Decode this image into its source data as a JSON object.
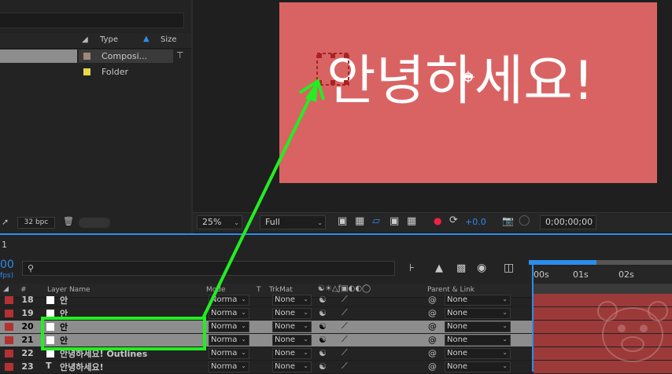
{
  "project": {
    "columns": {
      "tag": "",
      "type": "Type",
      "size": "Size"
    },
    "items": [
      {
        "type": "Composi...",
        "swatch_color": "#a08878",
        "selected": true
      },
      {
        "type": "Folder",
        "swatch_color": "#e8d84a",
        "selected": false
      }
    ],
    "bpc": "32 bpc"
  },
  "viewer": {
    "canvas_text": "안녕하세요!",
    "canvas_color": "#d96363",
    "zoom": "25%",
    "resolution": "Full",
    "exposure": "+0.0",
    "timecode": "0;00;00;00"
  },
  "timeline": {
    "tab": "1",
    "timecode_fragment": "00",
    "fps_fragment": "fps)",
    "search_placeholder": "",
    "columns": {
      "num": "#",
      "layer_name": "Layer Name",
      "mode": "Mode",
      "t": "T",
      "trkmat": "TrkMat",
      "parent": "Parent & Link"
    },
    "ruler": [
      "00s",
      "01s",
      "02s"
    ],
    "layers": [
      {
        "num": "18",
        "name": "안",
        "mode": "Norma",
        "trkmat": "None",
        "parent": "None",
        "type": "box",
        "selected": false
      },
      {
        "num": "19",
        "name": "안",
        "mode": "Norma",
        "trkmat": "None",
        "parent": "None",
        "type": "box",
        "selected": false
      },
      {
        "num": "20",
        "name": "안",
        "mode": "Norma",
        "trkmat": "None",
        "parent": "None",
        "type": "box",
        "selected": true
      },
      {
        "num": "21",
        "name": "안",
        "mode": "Norma",
        "trkmat": "None",
        "parent": "None",
        "type": "box",
        "selected": true
      },
      {
        "num": "22",
        "name": "안녕하세요! Outlines",
        "mode": "Norma",
        "trkmat": "None",
        "parent": "None",
        "type": "box",
        "selected": false
      },
      {
        "num": "23",
        "name": "안녕하세요!",
        "mode": "Norma",
        "trkmat": "None",
        "parent": "None",
        "type": "text",
        "selected": false
      }
    ]
  },
  "annotation": {
    "color": "#22ee22"
  }
}
